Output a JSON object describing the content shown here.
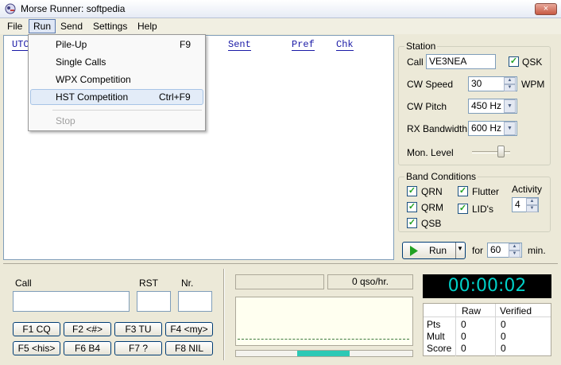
{
  "window": {
    "title": "Morse Runner: softpedia",
    "close_icon": "×"
  },
  "menu": {
    "items": [
      "File",
      "Run",
      "Send",
      "Settings",
      "Help"
    ]
  },
  "run_menu": {
    "items": [
      {
        "label": "Pile-Up",
        "shortcut": "F9"
      },
      {
        "label": "Single Calls",
        "shortcut": ""
      },
      {
        "label": "WPX Competition",
        "shortcut": ""
      },
      {
        "label": "HST Competition",
        "shortcut": "Ctrl+F9"
      },
      {
        "label": "Stop",
        "shortcut": ""
      }
    ]
  },
  "log": {
    "columns": [
      "UTC",
      "Sent",
      "Pref",
      "Chk"
    ]
  },
  "station": {
    "title": "Station",
    "call_label": "Call",
    "call_value": "VE3NEA",
    "qsk_label": "QSK",
    "qsk_checked": true,
    "cw_speed_label": "CW Speed",
    "cw_speed_value": "30",
    "wpm_label": "WPM",
    "cw_pitch_label": "CW Pitch",
    "cw_pitch_value": "450 Hz",
    "rx_bw_label": "RX Bandwidth",
    "rx_bw_value": "600 Hz",
    "mon_level_label": "Mon. Level"
  },
  "band": {
    "title": "Band Conditions",
    "qrn": "QRN",
    "qrm": "QRM",
    "qsb": "QSB",
    "flutter": "Flutter",
    "lids": "LID's",
    "activity_label": "Activity",
    "activity_value": "4"
  },
  "run_control": {
    "run_label": "Run",
    "for_label": "for",
    "minutes_value": "60",
    "min_label": "min."
  },
  "entry": {
    "call_label": "Call",
    "rst_label": "RST",
    "nr_label": "Nr."
  },
  "fkeys": [
    [
      "F1  CQ",
      "F2  <#>",
      "F3  TU",
      "F4  <my>"
    ],
    [
      "F5  <his>",
      "F6  B4",
      "F7  ?",
      "F8  NIL"
    ]
  ],
  "rate": {
    "text": "0  qso/hr."
  },
  "clock": {
    "time": "00:00:02"
  },
  "score": {
    "headers": [
      "Raw",
      "Verified"
    ],
    "rows": [
      {
        "label": "Pts",
        "raw": "0",
        "verified": "0"
      },
      {
        "label": "Mult",
        "raw": "0",
        "verified": "0"
      },
      {
        "label": "Score",
        "raw": "0",
        "verified": "0"
      }
    ]
  },
  "colors": {
    "lcd_text": "#00d0c8",
    "log_header": "#1a1aa6",
    "check_mark": "#21a121"
  }
}
